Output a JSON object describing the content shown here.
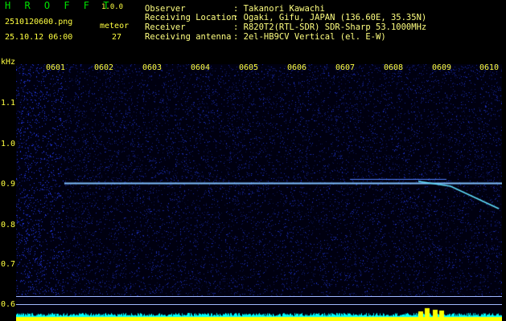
{
  "app": {
    "title": "H R O F F T",
    "version": "1.0.0"
  },
  "file": {
    "name": "2510120600.png",
    "datetime": "25.10.12 06:00"
  },
  "meteor": {
    "label": "meteor",
    "count": "27"
  },
  "info": [
    {
      "label": "Observer",
      "value": ": Takanori Kawachi"
    },
    {
      "label": "Receiving Location",
      "value": ": Ogaki, Gifu, JAPAN (136.60E, 35.35N)"
    },
    {
      "label": "Receiver",
      "value": ": R820T2(RTL-SDR) SDR-Sharp 53.1000MHz"
    },
    {
      "label": "Receiving antenna",
      "value": ": 2el-HB9CV Vertical (el. E-W)"
    }
  ],
  "axis": {
    "y_unit": "kHz",
    "y_ticks": [
      "1.1",
      "1.0",
      "0.9",
      "0.8",
      "0.7",
      "0.6"
    ],
    "x_ticks": [
      "0601",
      "0602",
      "0603",
      "0604",
      "0605",
      "0606",
      "0607",
      "0608",
      "0609",
      "0610"
    ]
  },
  "colors": {
    "text": "#ffff40",
    "title": "#00e000",
    "carrier": "#80c0ff",
    "meteor": "#60e0ff",
    "level": "#00ffff",
    "burst": "#ffff00"
  }
}
